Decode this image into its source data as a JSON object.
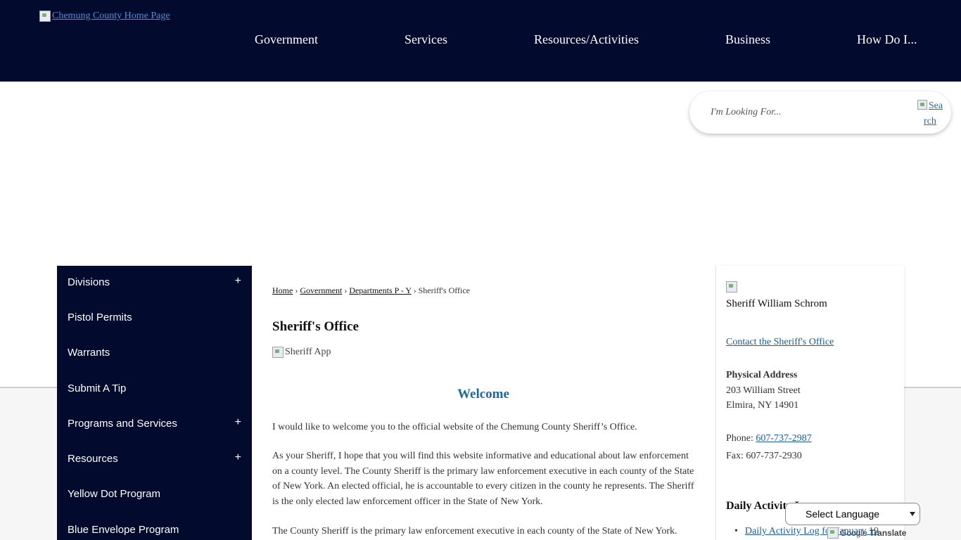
{
  "header": {
    "logo_alt": "Chemung County Home Page",
    "nav": [
      "Government",
      "Services",
      "Resources/Activities",
      "Business",
      "How Do I..."
    ]
  },
  "search": {
    "placeholder": "I'm Looking For...",
    "button_alt": "Search"
  },
  "sidebar": {
    "items": [
      {
        "label": "Divisions",
        "expandable": "+"
      },
      {
        "label": "Pistol Permits",
        "expandable": ""
      },
      {
        "label": "Warrants",
        "expandable": ""
      },
      {
        "label": "Submit A Tip",
        "expandable": ""
      },
      {
        "label": "Programs and Services",
        "expandable": "+"
      },
      {
        "label": "Resources",
        "expandable": "+"
      },
      {
        "label": "Yellow Dot Program",
        "expandable": ""
      },
      {
        "label": "Blue Envelope Program",
        "expandable": ""
      }
    ]
  },
  "breadcrumb": {
    "items": [
      "Home",
      "Government",
      "Departments P - Y"
    ],
    "separator": "›",
    "current": "Sheriff's Office"
  },
  "main": {
    "title": "Sheriff's Office",
    "image_alt": "Sheriff App",
    "welcome": "Welcome",
    "paragraphs": [
      "I would like to welcome you to the official website of the Chemung County Sheriff’s Office.",
      "As your Sheriff, I hope that you will find this website informative and educational about law enforcement on a county level. The County Sheriff is the primary law enforcement executive in each county of the State of New York. An elected official, he is accountable to every citizen in the county he represents. The Sheriff is the only elected law enforcement officer in the State of New York.",
      "The County Sheriff is the primary law enforcement executive in each county of the State of New York."
    ]
  },
  "right": {
    "sheriff_name": "Sheriff William Schrom",
    "contact_link": "Contact the Sheriff's Office",
    "address_heading": "Physical Address",
    "address_line1": "203 William Street",
    "address_line2": "Elmira, NY 14901",
    "phone_label": "Phone:",
    "phone": "607-737-2987",
    "fax": "Fax: 607-737-2930",
    "daily_heading": "Daily Activity Log",
    "daily_item": "Daily Activity Log for January 19"
  },
  "translate": {
    "select_label": "Select Language",
    "powered_by": "Google",
    "translate_label": "Translate"
  }
}
